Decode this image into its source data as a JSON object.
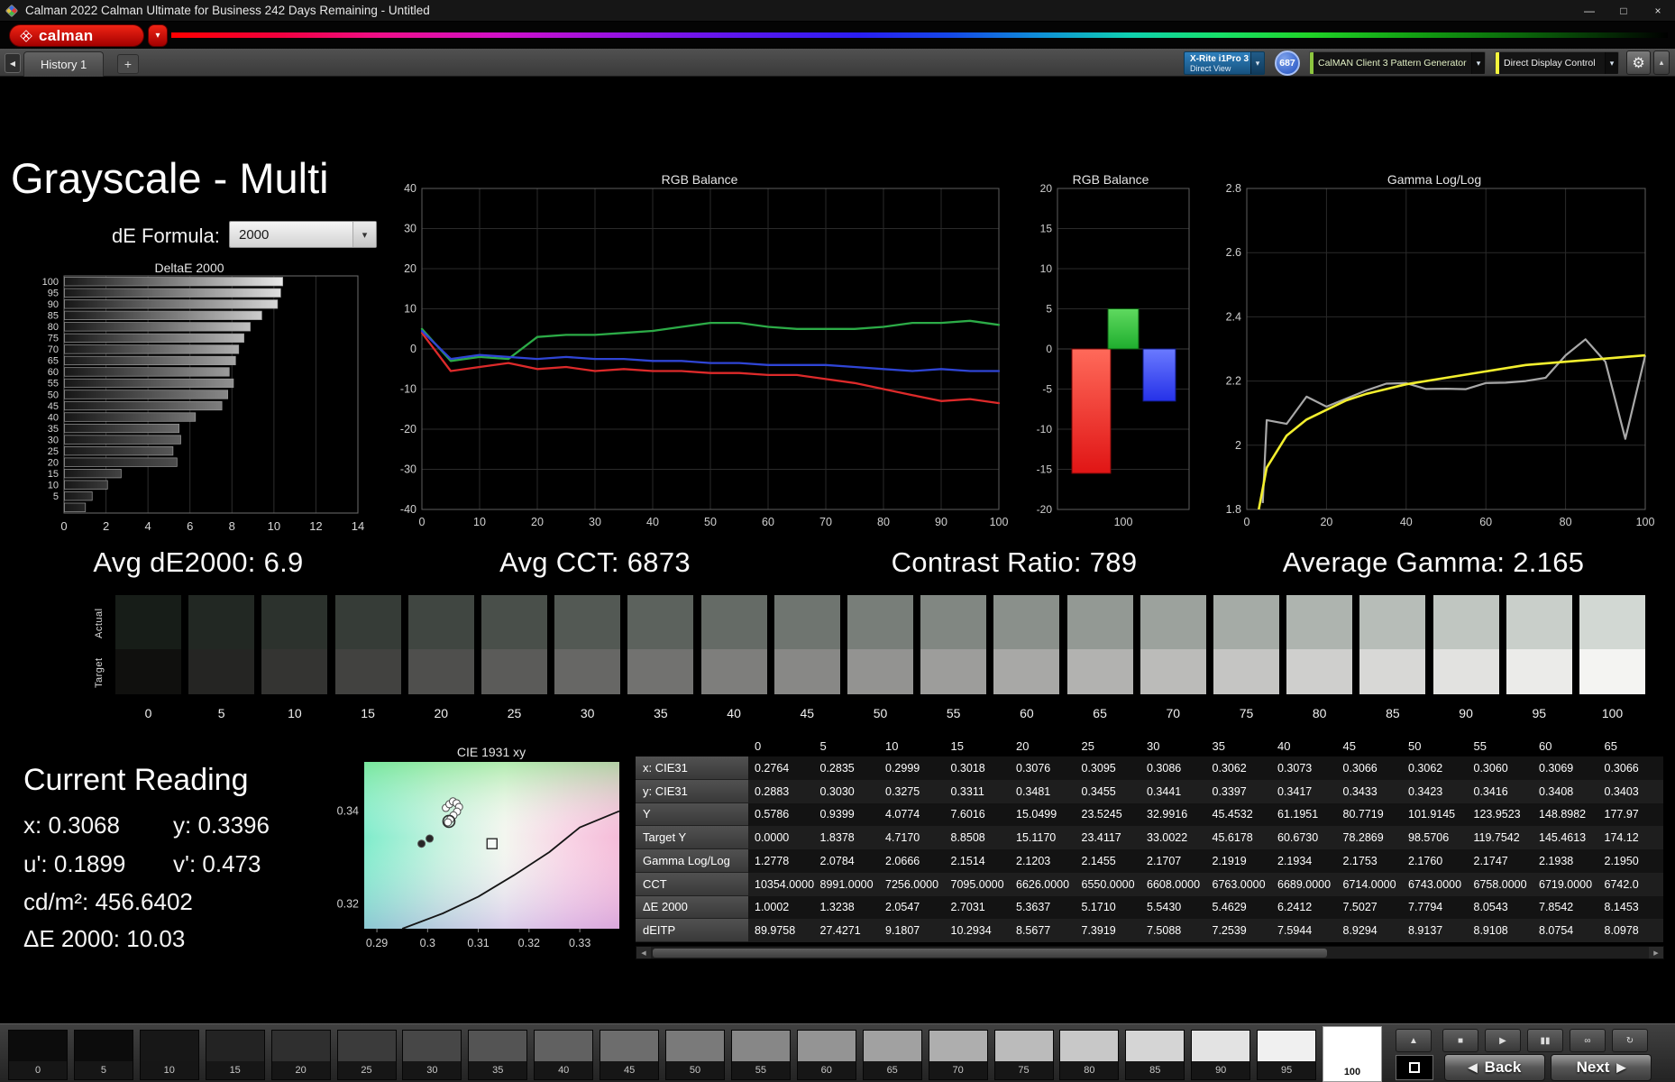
{
  "icons": {
    "minimize": "—",
    "maximize": "□",
    "close": "×",
    "dropdown": "▾",
    "add": "+",
    "collapse_left": "◀",
    "gear": "⚙",
    "corner": "▴",
    "up": "▲",
    "back_arrow": "◀",
    "next_arrow": "▶",
    "scroll_left": "◀",
    "scroll_right": "▶"
  },
  "title_bar": {
    "app_title": "Calman 2022 Calman Ultimate for Business 242 Days Remaining  - Untitled"
  },
  "toolbar": {
    "logo_text": "calman",
    "meter_button": {
      "line1": "X-Rite i1Pro 3",
      "line2": "Direct View"
    },
    "badge": "687",
    "pattern_button": "CalMAN Client 3 Pattern Generator",
    "display_button": "Direct Display Control"
  },
  "tabs": {
    "active": "History 1",
    "add": "+"
  },
  "page": {
    "title": "Grayscale - Multi",
    "de_formula_label": "dE Formula:",
    "de_formula_value": "2000",
    "stats": [
      "Avg dE2000: 6.9",
      "Avg CCT: 6873",
      "Contrast Ratio: 789",
      "Average Gamma: 2.165"
    ]
  },
  "current_reading": {
    "title": "Current Reading",
    "x": "x: 0.3068",
    "y": "y: 0.3396",
    "u": "u': 0.1899",
    "v": "v': 0.473",
    "cd": "cd/m²: 456.6402",
    "de": "ΔE 2000: 10.03"
  },
  "swatch_strip": {
    "row_labels": [
      "Actual",
      "Target"
    ],
    "levels": [
      0,
      5,
      10,
      15,
      20,
      25,
      30,
      35,
      40,
      45,
      50,
      55,
      60,
      65,
      70,
      75,
      80,
      85,
      90,
      95,
      100
    ]
  },
  "table": {
    "columns": [
      "0",
      "5",
      "10",
      "15",
      "20",
      "25",
      "30",
      "35",
      "40",
      "45",
      "50",
      "55",
      "60",
      "65"
    ],
    "rows": [
      {
        "label": "x: CIE31",
        "values": [
          "0.2764",
          "0.2835",
          "0.2999",
          "0.3018",
          "0.3076",
          "0.3095",
          "0.3086",
          "0.3062",
          "0.3073",
          "0.3066",
          "0.3062",
          "0.3060",
          "0.3069",
          "0.3066"
        ]
      },
      {
        "label": "y: CIE31",
        "values": [
          "0.2883",
          "0.3030",
          "0.3275",
          "0.3311",
          "0.3481",
          "0.3455",
          "0.3441",
          "0.3397",
          "0.3417",
          "0.3433",
          "0.3423",
          "0.3416",
          "0.3408",
          "0.3403"
        ]
      },
      {
        "label": "Y",
        "values": [
          "0.5786",
          "0.9399",
          "4.0774",
          "7.6016",
          "15.0499",
          "23.5245",
          "32.9916",
          "45.4532",
          "61.1951",
          "80.7719",
          "101.9145",
          "123.9523",
          "148.8982",
          "177.97"
        ]
      },
      {
        "label": "Target Y",
        "values": [
          "0.0000",
          "1.8378",
          "4.7170",
          "8.8508",
          "15.1170",
          "23.4117",
          "33.0022",
          "45.6178",
          "60.6730",
          "78.2869",
          "98.5706",
          "119.7542",
          "145.4613",
          "174.12"
        ]
      },
      {
        "label": "Gamma Log/Log",
        "values": [
          "1.2778",
          "2.0784",
          "2.0666",
          "2.1514",
          "2.1203",
          "2.1455",
          "2.1707",
          "2.1919",
          "2.1934",
          "2.1753",
          "2.1760",
          "2.1747",
          "2.1938",
          "2.1950"
        ]
      },
      {
        "label": "CCT",
        "values": [
          "10354.0000",
          "8991.0000",
          "7256.0000",
          "7095.0000",
          "6626.0000",
          "6550.0000",
          "6608.0000",
          "6763.0000",
          "6689.0000",
          "6714.0000",
          "6743.0000",
          "6758.0000",
          "6719.0000",
          "6742.0"
        ]
      },
      {
        "label": "ΔE 2000",
        "values": [
          "1.0002",
          "1.3238",
          "2.0547",
          "2.7031",
          "5.3637",
          "5.1710",
          "5.5430",
          "5.4629",
          "6.2412",
          "7.5027",
          "7.7794",
          "8.0543",
          "7.8542",
          "8.1453"
        ]
      },
      {
        "label": "dEITP",
        "values": [
          "89.9758",
          "27.4271",
          "9.1807",
          "10.2934",
          "8.5677",
          "7.3919",
          "7.5088",
          "7.2539",
          "7.5944",
          "8.9294",
          "8.9137",
          "8.9108",
          "8.0754",
          "8.0978"
        ]
      }
    ]
  },
  "bottom_bar": {
    "levels": [
      0,
      5,
      10,
      15,
      20,
      25,
      30,
      35,
      40,
      45,
      50,
      55,
      60,
      65,
      70,
      75,
      80,
      85,
      90,
      95,
      100
    ],
    "selected": 100,
    "controls": [
      {
        "name": "stop",
        "glyph": "■"
      },
      {
        "name": "play",
        "glyph": "▶"
      },
      {
        "name": "pause",
        "glyph": "▮▮"
      },
      {
        "name": "loop",
        "glyph": "∞"
      },
      {
        "name": "refresh",
        "glyph": "↻"
      }
    ],
    "back": "Back",
    "next": "Next"
  },
  "chart_data": [
    {
      "id": "deltae_bars",
      "type": "bar",
      "orientation": "horizontal",
      "title": "DeltaE 2000",
      "categories": [
        0,
        5,
        10,
        15,
        20,
        25,
        30,
        35,
        40,
        45,
        50,
        55,
        60,
        65,
        70,
        75,
        80,
        85,
        90,
        95,
        100
      ],
      "values": [
        1.0,
        1.32,
        2.05,
        2.7,
        5.36,
        5.17,
        5.54,
        5.46,
        6.24,
        7.5,
        7.78,
        8.05,
        7.85,
        8.15,
        8.3,
        8.55,
        8.85,
        9.4,
        10.15,
        10.3,
        10.4
      ],
      "xlim": [
        0,
        14
      ],
      "xticks": [
        0,
        2,
        4,
        6,
        8,
        10,
        12,
        14
      ]
    },
    {
      "id": "rgb_balance_lines",
      "type": "line",
      "title": "RGB Balance",
      "x": [
        0,
        5,
        10,
        15,
        20,
        25,
        30,
        35,
        40,
        45,
        50,
        55,
        60,
        65,
        70,
        75,
        80,
        85,
        90,
        95,
        100
      ],
      "series": [
        {
          "name": "Red",
          "color": "#dd2a2a",
          "values": [
            4,
            -5.5,
            -4.5,
            -3.5,
            -5,
            -4.5,
            -5.5,
            -5,
            -5.5,
            -5.5,
            -6,
            -6,
            -6.5,
            -6.5,
            -7.5,
            -8.5,
            -10,
            -11.5,
            -13,
            -12.5,
            -13.5
          ]
        },
        {
          "name": "Green",
          "color": "#2cab47",
          "values": [
            5,
            -3,
            -2,
            -2.5,
            3,
            3.5,
            3.5,
            4,
            4.5,
            5.5,
            6.5,
            6.5,
            5.5,
            5,
            5,
            5,
            5.5,
            6.5,
            6.5,
            7,
            6
          ]
        },
        {
          "name": "Blue",
          "color": "#2f45d5",
          "values": [
            4.5,
            -2.5,
            -1.5,
            -2,
            -2.5,
            -2,
            -2.5,
            -2.5,
            -3,
            -3,
            -3.5,
            -3.5,
            -4,
            -4,
            -4,
            -4.5,
            -5,
            -5.5,
            -5,
            -5.5,
            -5.5
          ]
        }
      ],
      "ylim": [
        -40,
        40
      ],
      "yticks": [
        -40,
        -30,
        -20,
        -10,
        0,
        10,
        20,
        30,
        40
      ],
      "xticks": [
        0,
        10,
        20,
        30,
        40,
        50,
        60,
        70,
        80,
        90,
        100
      ],
      "grid": true
    },
    {
      "id": "rgb_balance_bars",
      "type": "bar",
      "title": "RGB Balance",
      "categories": [
        "Red",
        "Green",
        "Blue"
      ],
      "values": [
        -15.5,
        5,
        -6.5
      ],
      "colors": [
        "#e01515",
        "#1fae2e",
        "#2531e8"
      ],
      "colors_light": [
        "#ff6a5a",
        "#5fd95f",
        "#6a7aff"
      ],
      "colors_dark": [
        "#7a0808",
        "#0c5f12",
        "#101a8a"
      ],
      "ylim": [
        -20,
        20
      ],
      "yticks": [
        -20,
        -15,
        -10,
        -5,
        0,
        5,
        10,
        15,
        20
      ],
      "xlabel": "100"
    },
    {
      "id": "gamma_loglog",
      "type": "line",
      "title": "Gamma Log/Log",
      "series": [
        {
          "name": "Measured",
          "color": "#a8a8a8",
          "x": [
            4,
            5,
            10,
            15,
            20,
            25,
            30,
            35,
            40,
            45,
            50,
            55,
            60,
            65,
            70,
            75,
            80,
            85,
            90,
            95,
            100
          ],
          "values": [
            1.82,
            2.0784,
            2.0666,
            2.1514,
            2.1203,
            2.1455,
            2.1707,
            2.1919,
            2.1934,
            2.1753,
            2.176,
            2.1747,
            2.1938,
            2.195,
            2.2,
            2.21,
            2.28,
            2.33,
            2.26,
            2.02,
            2.28
          ]
        },
        {
          "name": "Target",
          "color": "#f3ef2e",
          "x": [
            3,
            5,
            10,
            15,
            20,
            25,
            30,
            40,
            50,
            60,
            70,
            80,
            90,
            100
          ],
          "values": [
            1.8,
            1.93,
            2.03,
            2.08,
            2.11,
            2.14,
            2.16,
            2.19,
            2.21,
            2.23,
            2.25,
            2.26,
            2.27,
            2.28
          ]
        }
      ],
      "ylim": [
        1.8,
        2.8
      ],
      "yticks": [
        1.8,
        2.0,
        2.2,
        2.4,
        2.6,
        2.8
      ],
      "ytick_labels": [
        "1.8",
        "2",
        "2.2",
        "2.4",
        "2.6",
        "2.8"
      ],
      "xlim": [
        0,
        100
      ],
      "xticks": [
        0,
        20,
        40,
        60,
        80,
        100
      ]
    },
    {
      "id": "cie_1931_xy",
      "type": "scatter",
      "title": "CIE 1931 xy",
      "xlim": [
        0.2875,
        0.3378
      ],
      "ylim": [
        0.3147,
        0.3506
      ],
      "xticks": [
        "0.29",
        "0.3",
        "0.31",
        "0.32",
        "0.33"
      ],
      "xtick_values": [
        0.29,
        0.3,
        0.31,
        0.32,
        0.33
      ],
      "yticks": [
        "0.34",
        "0.32"
      ],
      "ytick_values": [
        0.34,
        0.32
      ],
      "locus": [
        [
          0.295,
          0.3147
        ],
        [
          0.303,
          0.318
        ],
        [
          0.31,
          0.3216
        ],
        [
          0.317,
          0.3262
        ],
        [
          0.324,
          0.3312
        ],
        [
          0.33,
          0.3365
        ],
        [
          0.3378,
          0.34
        ]
      ],
      "points": [
        [
          0.3036,
          0.3407
        ],
        [
          0.3043,
          0.3415
        ],
        [
          0.305,
          0.3421
        ],
        [
          0.3057,
          0.3417
        ],
        [
          0.3062,
          0.3409
        ],
        [
          0.3058,
          0.3399
        ],
        [
          0.3051,
          0.3391
        ],
        [
          0.3045,
          0.3383
        ],
        [
          0.304,
          0.3376
        ]
      ],
      "dark_points": [
        [
          0.2988,
          0.333
        ],
        [
          0.3004,
          0.3341
        ]
      ],
      "current": [
        0.3042,
        0.3378
      ],
      "target_square": [
        0.3127,
        0.333
      ]
    }
  ]
}
